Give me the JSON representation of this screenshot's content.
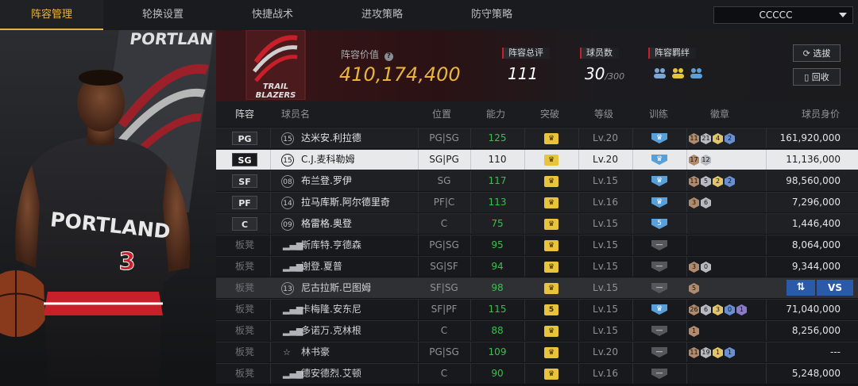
{
  "nav": {
    "tabs": [
      "阵容管理",
      "轮换设置",
      "快捷战术",
      "进攻策略",
      "防守策略"
    ],
    "active_index": 0,
    "team_select": "CCCCC"
  },
  "player_card": {
    "jersey_text": "PORTLAND",
    "jersey_number": "3",
    "bg_logo_text": "PORTLAN"
  },
  "team": {
    "logo_text_1": "TRAIL",
    "logo_text_2": "BLAZERS",
    "value_label": "阵容价值",
    "value": "410,174,400",
    "total_rating_label": "阵容总评",
    "total_rating": "111",
    "player_count_label": "球员数",
    "player_count": "30",
    "player_count_max": "/300",
    "synergy_label": "阵容羁绊",
    "buttons": {
      "select": "选拔",
      "recycle": "回收"
    }
  },
  "table": {
    "headers": [
      "阵容",
      "球员名",
      "位置",
      "能力",
      "突破",
      "等级",
      "训练",
      "徽章",
      "球员身价"
    ],
    "rows": [
      {
        "slot": "PG",
        "num": "15",
        "name": "达米安.利拉德",
        "pos": "PG|SG",
        "rating": "125",
        "level": "Lv.20",
        "train": "blue",
        "badges": [
          "11",
          "21",
          "4",
          "2"
        ],
        "value": "161,920,000",
        "starter": true
      },
      {
        "slot": "SG",
        "num": "15",
        "name": "C.J.麦科勒姆",
        "pos": "SG|PG",
        "rating": "110",
        "level": "Lv.20",
        "train": "blue",
        "badges": [
          "17",
          "12"
        ],
        "value": "11,136,000",
        "starter": true,
        "selected": true
      },
      {
        "slot": "SF",
        "num": "08",
        "name": "布兰登.罗伊",
        "pos": "SG",
        "rating": "117",
        "level": "Lv.15",
        "train": "blue",
        "badges": [
          "11",
          "5",
          "2",
          "2"
        ],
        "value": "98,560,000",
        "starter": true
      },
      {
        "slot": "PF",
        "num": "14",
        "name": "拉马库斯.阿尔德里奇",
        "pos": "PF|C",
        "rating": "113",
        "level": "Lv.16",
        "train": "blue",
        "badges": [
          "3",
          "6"
        ],
        "value": "7,296,000",
        "starter": true
      },
      {
        "slot": "C",
        "num": "09",
        "name": "格雷格.奥登",
        "pos": "C",
        "rating": "75",
        "level": "Lv.15",
        "train": "5",
        "badges": [],
        "value": "1,446,400",
        "starter": true
      },
      {
        "slot": "板凳",
        "num": "",
        "name": "斯库特.亨德森",
        "pos": "PG|SG",
        "rating": "95",
        "level": "Lv.15",
        "train": "gray",
        "badges": [],
        "value": "8,064,000",
        "starter": false
      },
      {
        "slot": "板凳",
        "num": "",
        "name": "谢登.夏普",
        "pos": "SG|SF",
        "rating": "94",
        "level": "Lv.15",
        "train": "gray",
        "badges": [
          "3",
          "0"
        ],
        "value": "9,344,000",
        "starter": false
      },
      {
        "slot": "板凳",
        "num": "13",
        "name": "尼古拉斯.巴图姆",
        "pos": "SF|SG",
        "rating": "98",
        "level": "Lv.15",
        "train": "gray",
        "badges": [
          "5"
        ],
        "value": "",
        "starter": false,
        "hover": true
      },
      {
        "slot": "板凳",
        "num": "",
        "name": "卡梅隆.安东尼",
        "pos": "SF|PF",
        "rating": "115",
        "level": "Lv.15",
        "train": "blue",
        "break": "5",
        "badges": [
          "26",
          "6",
          "3",
          "0",
          "1"
        ],
        "value": "71,040,000",
        "starter": false
      },
      {
        "slot": "板凳",
        "num": "",
        "name": "多诺万.克林根",
        "pos": "C",
        "rating": "88",
        "level": "Lv.15",
        "train": "gray",
        "badges": [
          "1"
        ],
        "value": "8,256,000",
        "starter": false
      },
      {
        "slot": "板凳",
        "num": "",
        "name": "林书豪",
        "pos": "PG|SG",
        "rating": "109",
        "level": "Lv.20",
        "train": "gray",
        "badges": [
          "11",
          "19",
          "1",
          "1"
        ],
        "value": "---",
        "starter": false
      },
      {
        "slot": "板凳",
        "num": "",
        "name": "德安德烈.艾顿",
        "pos": "C",
        "rating": "90",
        "level": "Lv.16",
        "train": "gray",
        "badges": [],
        "value": "5,248,000",
        "starter": false
      }
    ],
    "hover_actions": {
      "swap": "⇅",
      "vs": "VS"
    }
  },
  "colors": {
    "accent": "#e9b43d",
    "rating_green": "#36c24a",
    "team_red": "#c8202b",
    "train_blue": "#5aa0d8"
  }
}
